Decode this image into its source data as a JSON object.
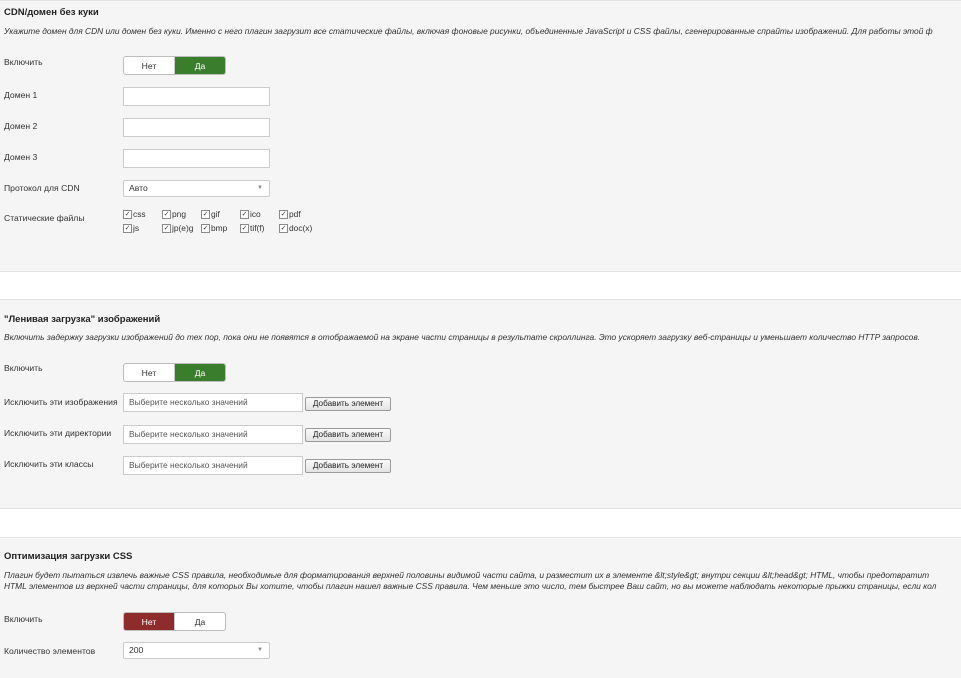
{
  "cdn": {
    "legend": "CDN/домен без куки",
    "description": "Укажите домен для CDN или домен без куки. Именно с него плагин загрузит все статические файлы, включая фоновые рисунки, объединенные JavaScript и CSS файлы, сгенерированные спрайты изображений. Для работы этой ф",
    "enable_label": "Включить",
    "toggle_no": "Нет",
    "toggle_yes": "Да",
    "toggle_selected": "Да",
    "domain1_label": "Домен 1",
    "domain1_value": "",
    "domain2_label": "Домен 2",
    "domain2_value": "",
    "domain3_label": "Домен 3",
    "domain3_value": "",
    "protocol_label": "Протокол для CDN",
    "protocol_value": "Авто",
    "static_label": "Статические файлы",
    "filetypes": [
      "css",
      "png",
      "gif",
      "ico",
      "pdf",
      "js",
      "jp(e)g",
      "bmp",
      "tif(f)",
      "doc(x)"
    ]
  },
  "lazy": {
    "legend": "\"Ленивая загрузка\" изображений",
    "description": "Включить задержку загрузки изображений до тех пор, пока они не появятся в отображаемой на экране части страницы в результате скроллинга. Это ускоряет загрузку веб-страницы и уменьшает количество HTTP запросов.",
    "enable_label": "Включить",
    "toggle_no": "Нет",
    "toggle_yes": "Да",
    "toggle_selected": "Да",
    "exclude_images_label": "Исключить эти изображения",
    "exclude_dirs_label": "Исключить эти директории",
    "exclude_classes_label": "Исключить эти классы",
    "multi_placeholder": "Выберите несколько значений",
    "add_button": "Добавить элемент"
  },
  "css": {
    "legend": "Оптимизация загрузки CSS",
    "description_line1": "Плагин будет пытаться извлечь важные CSS правила, необходимые для форматирования верхней половины видимой части сайта, и разместит их в элементе &lt;style&gt; внутри секции &lt;head&gt; HTML, чтобы предотвратит",
    "description_line2": "HTML элементов из верхней части страницы, для которых Вы хотите, чтобы плагин нашел важные CSS правила. Чем меньше это число, тем быстрее Ваш сайт, но вы можете наблюдать некоторые прыжки страницы, если кол",
    "enable_label": "Включить",
    "toggle_no": "Нет",
    "toggle_yes": "Да",
    "toggle_selected": "Нет",
    "count_label": "Количество элементов",
    "count_value": "200"
  },
  "colors": {
    "toggle_yes_active": "#3a7d2c",
    "toggle_no_active": "#8e2b2b",
    "panel_bg": "#f5f5f5"
  }
}
